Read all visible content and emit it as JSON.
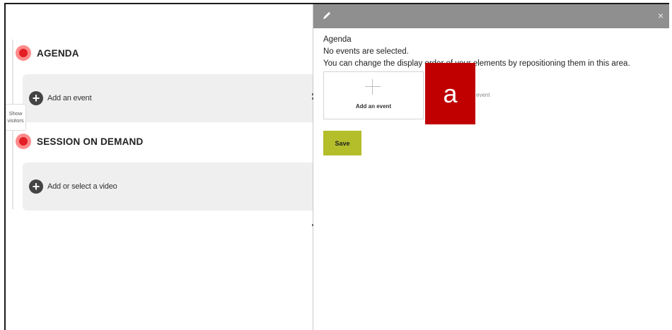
{
  "left_panel": {
    "show_visitors": [
      "Show",
      "visitors"
    ],
    "sections": [
      {
        "title": "AGENDA",
        "add_label": "Add an event"
      },
      {
        "title": "SESSION ON DEMAND",
        "add_label": "Add or select a video"
      }
    ]
  },
  "modal": {
    "close_symbol": "×",
    "lines": [
      "Agenda",
      "No events are selected.",
      "You can change the display order of your elements by repositioning them in this area."
    ],
    "widget_label": "Add an event",
    "ghost_label": "event",
    "save_label": "Save"
  },
  "callout": {
    "label": "a"
  },
  "colors": {
    "record_outer": "#ff8a8a",
    "record_inner": "#e31e24",
    "modal_header": "#8f8f8f",
    "save_button": "#b4bd2a",
    "callout_box": "#c00000"
  }
}
